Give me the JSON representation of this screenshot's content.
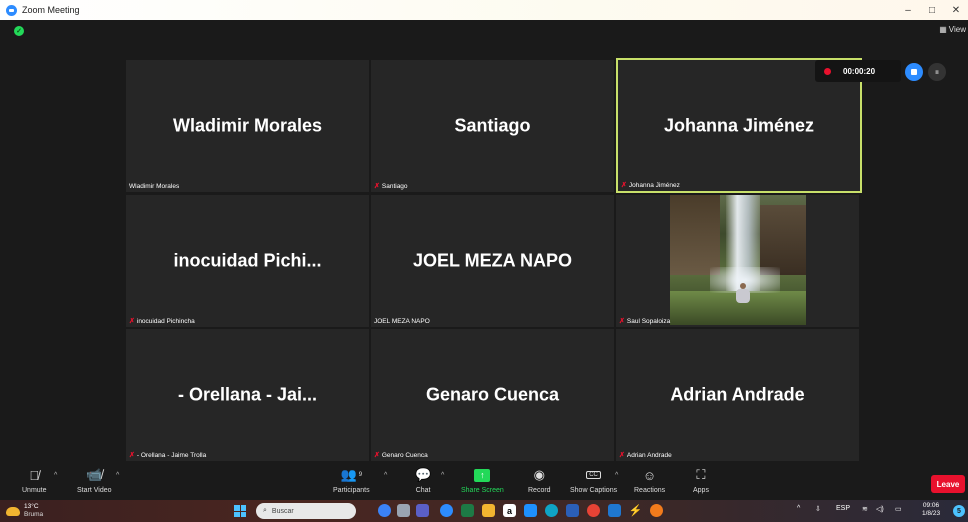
{
  "window": {
    "title": "Zoom Meeting",
    "controls": {
      "minimize": "–",
      "restore": "□",
      "close": "✕"
    }
  },
  "topbar": {
    "view_label": "View",
    "view_icon": "grid-icon"
  },
  "recording": {
    "time": "00:00:20"
  },
  "tiles": [
    {
      "display": "Wladimir Morales",
      "label": "Wladimir Morales",
      "muted": false,
      "active": false
    },
    {
      "display": "Santiago",
      "label": "Santiago",
      "muted": true,
      "active": false
    },
    {
      "display": "Johanna Jiménez",
      "label": "Johanna Jiménez",
      "muted": true,
      "active": true
    },
    {
      "display": "inocuidad  Pichi...",
      "label": "inocuidad Pichincha",
      "muted": true,
      "active": false
    },
    {
      "display": "JOEL MEZA NAPO",
      "label": "JOEL MEZA NAPO",
      "muted": false,
      "active": false
    },
    {
      "display": "",
      "label": "Saul Sopaloiza",
      "muted": true,
      "active": false,
      "video": true
    },
    {
      "display": "- Orellana - Jai...",
      "label": "- Orellana - Jaime Trolla",
      "muted": true,
      "active": false
    },
    {
      "display": "Genaro Cuenca",
      "label": "Genaro Cuenca",
      "muted": true,
      "active": false
    },
    {
      "display": "Adrian Andrade",
      "label": "Adrian Andrade",
      "muted": true,
      "active": false
    }
  ],
  "controlbar": {
    "unmute": "Unmute",
    "start_video": "Start Video",
    "participants": "Participants",
    "participants_count": "9",
    "chat": "Chat",
    "share_screen": "Share Screen",
    "record": "Record",
    "show_captions": "Show Captions",
    "reactions": "Reactions",
    "apps": "Apps",
    "leave": "Leave",
    "captions_icon_text": "CC"
  },
  "taskbar": {
    "temperature": "13°C",
    "weather": "Bruma",
    "search_placeholder": "Buscar",
    "language": "ESP",
    "time": "09:06",
    "date": "1/8/23",
    "notification_count": "5"
  },
  "colors": {
    "accent_blue": "#2d8cff",
    "share_green": "#23d959",
    "leave_red": "#e8112d",
    "active_border": "#c8e06a",
    "tile_bg": "#262626"
  }
}
